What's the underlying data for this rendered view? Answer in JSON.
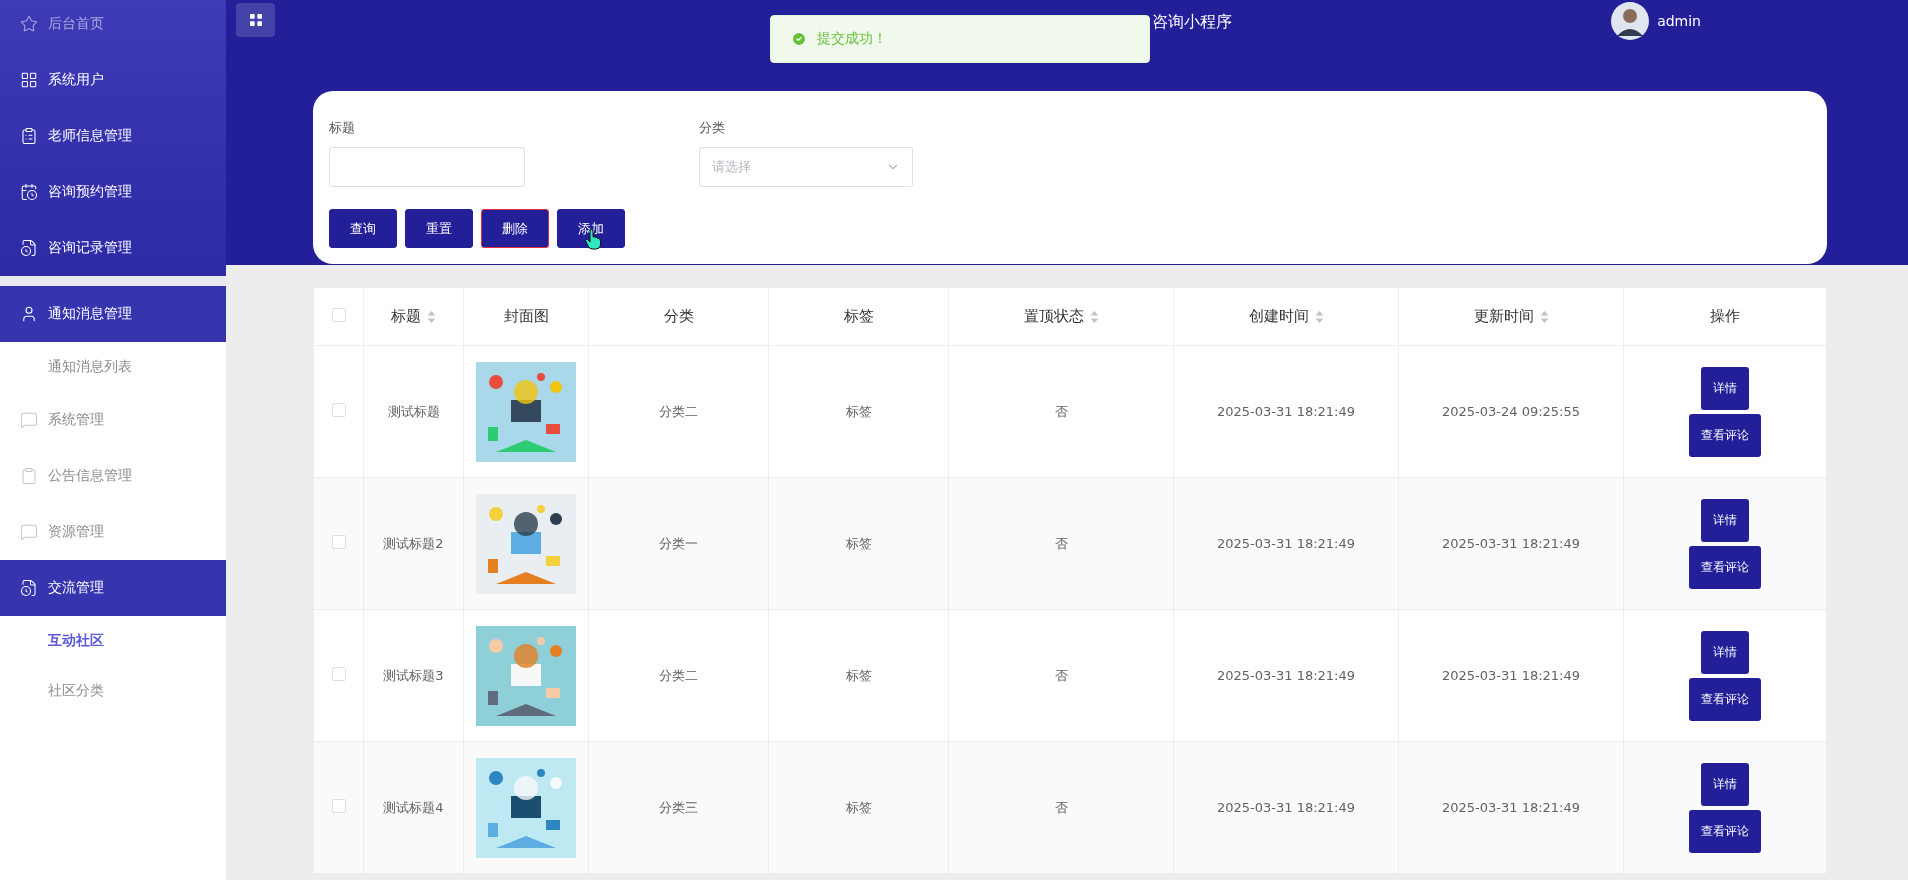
{
  "sidebar": {
    "items": [
      {
        "kind": "top",
        "label": "后台首页",
        "dimmed": true
      },
      {
        "kind": "top",
        "label": "系统用户",
        "dimmed": false
      },
      {
        "kind": "top",
        "label": "老师信息管理",
        "dimmed": false
      },
      {
        "kind": "top",
        "label": "咨询预约管理",
        "dimmed": false
      },
      {
        "kind": "top",
        "label": "咨询记录管理",
        "dimmed": false
      },
      {
        "kind": "group",
        "label": "通知消息管理"
      },
      {
        "kind": "child",
        "label": "通知消息列表",
        "selected": false
      },
      {
        "kind": "plain",
        "label": "系统管理"
      },
      {
        "kind": "plain",
        "label": "公告信息管理"
      },
      {
        "kind": "plain",
        "label": "资源管理"
      },
      {
        "kind": "group",
        "label": "交流管理"
      },
      {
        "kind": "child",
        "label": "互动社区",
        "selected": true
      },
      {
        "kind": "child",
        "label": "社区分类",
        "selected": false
      }
    ]
  },
  "header": {
    "title": "咨询小程序",
    "user": "admin"
  },
  "toast": {
    "message": "提交成功！"
  },
  "search": {
    "fields": [
      {
        "label": "标题",
        "kind": "input"
      },
      {
        "label": "分类",
        "kind": "select",
        "placeholder": "请选择"
      }
    ],
    "buttons": [
      {
        "label": "查询",
        "focused": false
      },
      {
        "label": "重置",
        "focused": false
      },
      {
        "label": "删除",
        "focused": true
      },
      {
        "label": "添加",
        "focused": false,
        "hovered": true
      }
    ]
  },
  "table": {
    "columns": [
      {
        "kind": "check",
        "checked": false
      },
      {
        "label": "标题",
        "sortable": true
      },
      {
        "label": "封面图",
        "sortable": false
      },
      {
        "label": "分类",
        "sortable": false
      },
      {
        "label": "标签",
        "sortable": false
      },
      {
        "label": "置顶状态",
        "sortable": true
      },
      {
        "label": "创建时间",
        "sortable": true
      },
      {
        "label": "更新时间",
        "sortable": true
      },
      {
        "label": "操作",
        "sortable": false
      }
    ],
    "rows": [
      {
        "checked": false,
        "title": "测试标题",
        "category": "分类二",
        "tag": "标签",
        "pinned": "否",
        "created": "2025-03-31 18:21:49",
        "updated": "2025-03-24 09:25:55",
        "actions": [
          "详情",
          "查看评论"
        ]
      },
      {
        "checked": false,
        "title": "测试标题2",
        "category": "分类一",
        "tag": "标签",
        "pinned": "否",
        "created": "2025-03-31 18:21:49",
        "updated": "2025-03-31 18:21:49",
        "actions": [
          "详情",
          "查看评论"
        ]
      },
      {
        "checked": false,
        "title": "测试标题3",
        "category": "分类二",
        "tag": "标签",
        "pinned": "否",
        "created": "2025-03-31 18:21:49",
        "updated": "2025-03-31 18:21:49",
        "actions": [
          "详情",
          "查看评论"
        ]
      },
      {
        "checked": false,
        "title": "测试标题4",
        "category": "分类三",
        "tag": "标签",
        "pinned": "否",
        "created": "2025-03-31 18:21:49",
        "updated": "2025-03-31 18:21:49",
        "actions": [
          "详情",
          "查看评论"
        ]
      }
    ]
  }
}
